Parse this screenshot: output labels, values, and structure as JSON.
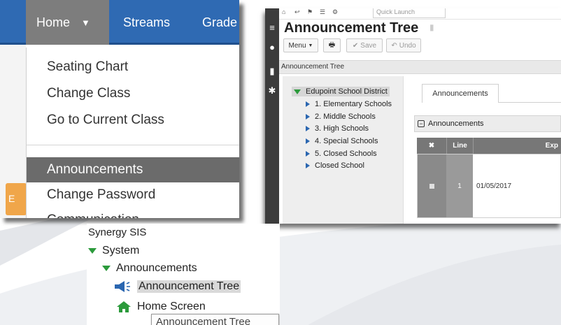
{
  "colors": {
    "nav_blue": "#2f6ab3",
    "home_gray": "#7d7d7d",
    "active_item": "#6b6b6b",
    "tree_green": "#2b9a3b",
    "tree_blue": "#2a66b0"
  },
  "nav": {
    "home_label": "Home",
    "caret_icon": "caret-down-icon",
    "tabs": [
      "Streams",
      "Grade"
    ],
    "orange_badge_letter": "E",
    "dropdown_items": [
      "Seating Chart",
      "Change Class",
      "Go to Current Class",
      "Announcements",
      "Change Password",
      "Communication"
    ]
  },
  "app": {
    "quick_launch_placeholder": "Quick Launch",
    "page_title": "Announcement Tree",
    "toolbar": {
      "menu_label": "Menu",
      "save_label": "Save",
      "undo_label": "Undo"
    },
    "breadcrumb": "Announcement Tree",
    "tree": {
      "root": "Edupoint School District",
      "children": [
        "1. Elementary Schools",
        "2. Middle Schools",
        "3. High Schools",
        "4. Special Schools",
        "5. Closed Schools",
        "Closed School"
      ]
    },
    "tab_label": "Announcements",
    "grid": {
      "title": "Announcements",
      "columns": [
        "Line",
        "Exp"
      ],
      "rows": [
        {
          "line": "1",
          "date": "01/05/2017"
        }
      ]
    }
  },
  "synergy": {
    "root": "Synergy SIS",
    "system": "System",
    "announcements": "Announcements",
    "announcement_tree": "Announcement Tree",
    "home_screen": "Home Screen",
    "tooltip": "Announcement Tree"
  }
}
